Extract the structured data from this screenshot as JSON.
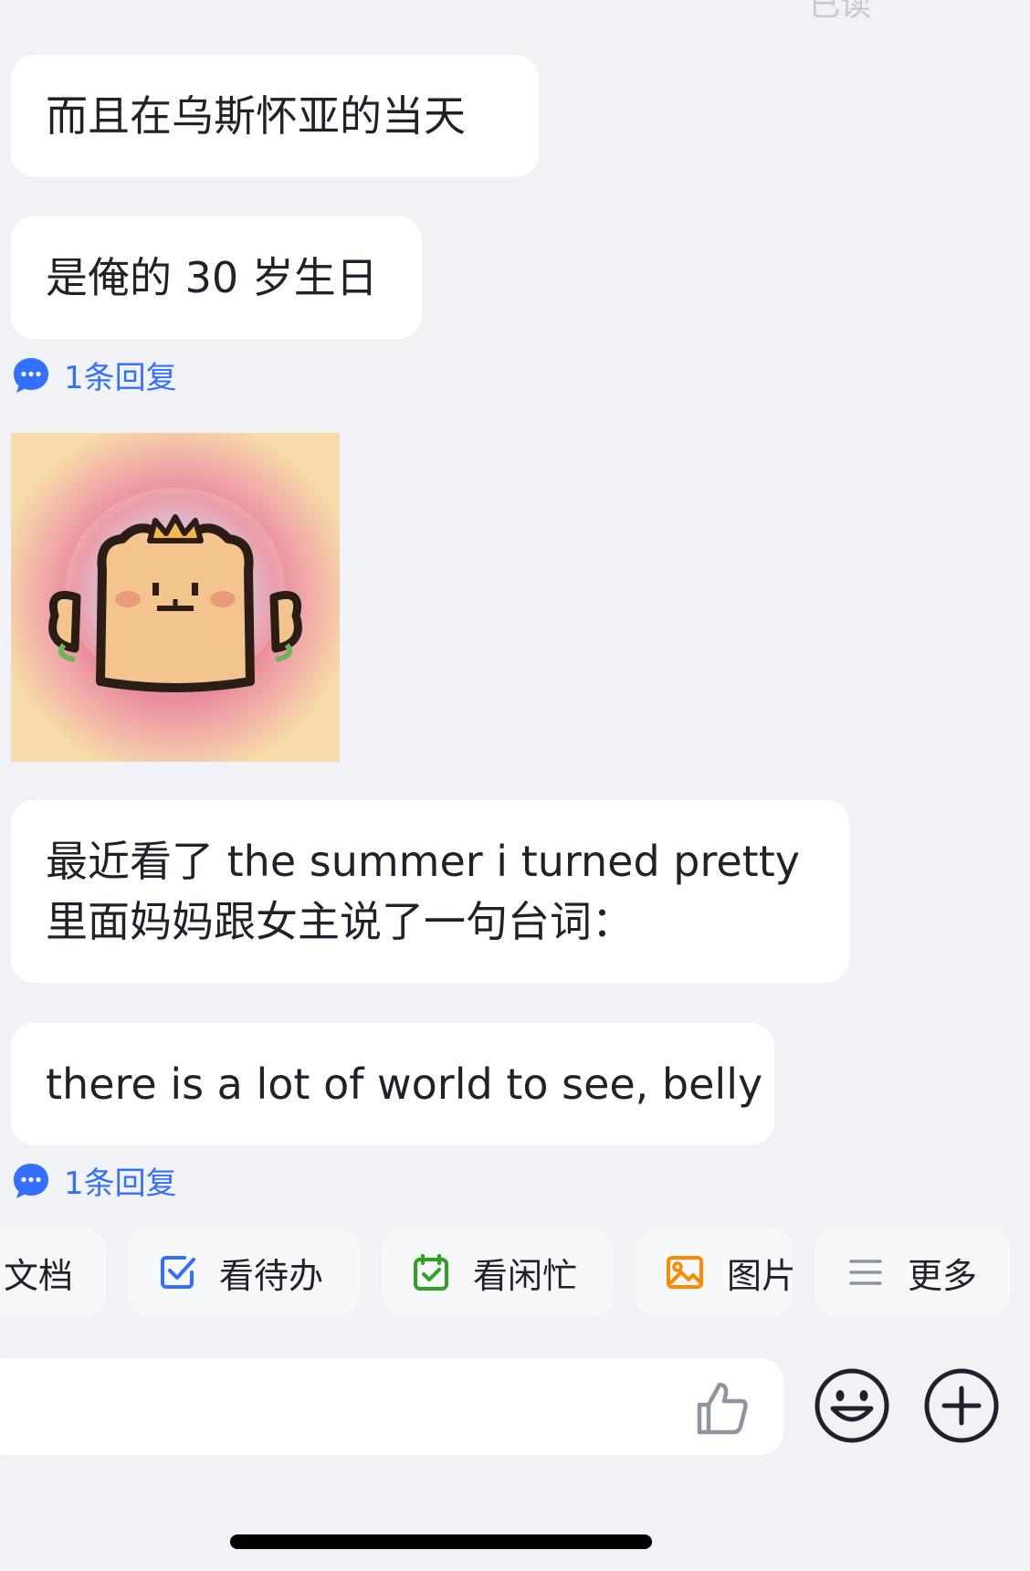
{
  "top_fragment": "已读",
  "messages": [
    {
      "text": "而且在乌斯怀亚的当天"
    },
    {
      "text": "是俺的 30 岁生日"
    },
    {
      "line1": "最近看了 the summer i turned pretty",
      "line2": "里面妈妈跟女主说了一句台词："
    },
    {
      "text": "there is a lot of world to see, belly"
    }
  ],
  "replies": [
    {
      "label": "1条回复"
    },
    {
      "label": "1条回复"
    }
  ],
  "sticker": {
    "icon": "bear-with-crown-sticker"
  },
  "quick_actions": [
    {
      "label": "文档",
      "icon": "doc-icon"
    },
    {
      "label": "看待办",
      "icon": "todo-checkbox-icon",
      "color": "#3370ff"
    },
    {
      "label": "看闲忙",
      "icon": "calendar-check-icon",
      "color": "#2ea121"
    },
    {
      "label": "图片",
      "icon": "image-icon",
      "color": "#ff8800"
    },
    {
      "label": "更多",
      "icon": "menu-lines-icon",
      "color": "#8f959e"
    }
  ],
  "composer": {
    "like_icon": "thumbs-up-icon",
    "emoji_icon": "emoji-smile-icon",
    "plus_icon": "plus-circle-icon"
  },
  "colors": {
    "background": "#f1f2f5",
    "bubble": "#ffffff",
    "link": "#3370ff",
    "text": "#1f2329"
  }
}
